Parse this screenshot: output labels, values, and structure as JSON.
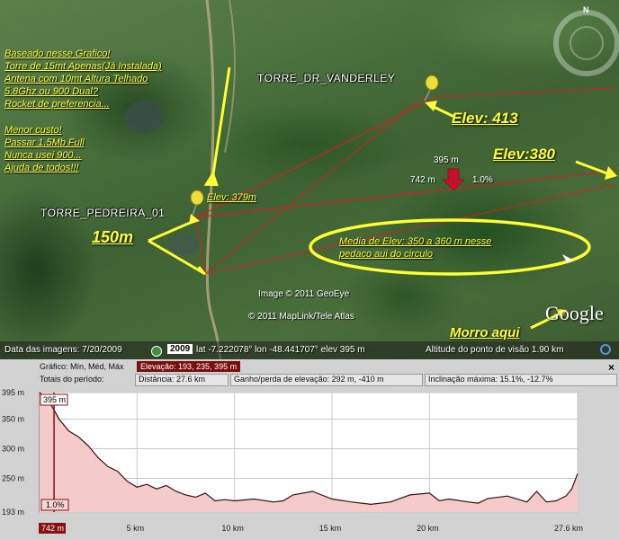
{
  "colors": {
    "annotation_yellow": "#ffff33",
    "path_red": "#d62020",
    "profile_fill": "#f4caca",
    "panel_bg": "#d2d2d2",
    "marker_red": "#c8102e"
  },
  "map": {
    "compass_n": "N",
    "annotations": {
      "note_lines": [
        "Baseado nesse Grafico!",
        "Torre de 15mt Apenas(Já Instalada)",
        "Antena com 10mt Altura Telhado",
        "5.8Ghz ou 900 Dual?",
        "Rocket de preferencia..."
      ],
      "cost_lines": [
        "Menor custo!",
        "Passar 1.5Mb Full",
        "Nunca usei 900...",
        "Ajuda de todos!!!"
      ],
      "elev_413": "Elev: 413",
      "elev_380": "Elev:380",
      "elev_379": "Elev: 379m",
      "dist_150": "150m",
      "circle_note_1": "Media de Elev: 350 a 360 m nesse",
      "circle_note_2": "pedaco aui do circulo",
      "morro": "Morro aqui"
    },
    "places": {
      "tower_dr": "TORRE_DR_VANDERLEY",
      "tower_pedreira": "TORRE_PEDREIRA_01"
    },
    "cursor_readout": {
      "elev": "395 m",
      "dist": "742 m",
      "slope": "1.0%"
    },
    "credits": {
      "geoeye": "Image © 2011 GeoEye",
      "maplink": "© 2011 MapLink/Tele Atlas",
      "google": "Google"
    },
    "status": {
      "image_date": "Data das imagens: 7/20/2009",
      "year_badge": "2009",
      "coords": "lat  -7.222078°  lon  -48.441707°  elev  395 m",
      "eye_alt": "Altitude do ponto de visão    1.90 km"
    }
  },
  "profile": {
    "legend": "Gráfico: Mín, Méd, Máx",
    "elev_box": "Elevação: 193, 235, 395 m",
    "totals_label": "Totais do período:",
    "distance": "Distância: 27.6 km",
    "gain_loss": "Ganho/perda de elevação: 292 m, -410 m",
    "max_slope": "Inclinação máxima: 15.1%, -12.7%",
    "close": "×",
    "cursor_value": "395 m",
    "cursor_slope": "1.0%",
    "cursor_x_label": "742 m"
  },
  "chart_data": {
    "type": "area",
    "title": "",
    "xlabel": "",
    "ylabel": "",
    "x_unit": "km",
    "y_unit": "m",
    "xlim": [
      0,
      27.6
    ],
    "ylim": [
      193,
      395
    ],
    "y_ticks": [
      "395 m",
      "350 m",
      "300 m",
      "250 m",
      "193 m"
    ],
    "y_tick_values": [
      395,
      350,
      300,
      250,
      193
    ],
    "x_ticks": [
      "5 km",
      "10 km",
      "15 km",
      "20 km",
      "27.6 km"
    ],
    "x_tick_values": [
      5,
      10,
      15,
      20,
      27.6
    ],
    "series": [
      {
        "x": [
          0,
          0.5,
          1,
          1.5,
          2,
          2.5,
          3,
          3.5,
          4,
          4.5,
          5,
          5.5,
          6,
          6.5,
          7,
          7.5,
          8,
          8.5,
          9,
          9.5,
          10,
          11,
          12,
          12.5,
          13,
          14,
          15,
          16,
          17,
          18,
          19,
          20,
          20.5,
          21,
          22,
          22.5,
          23,
          24,
          25,
          25.5,
          26,
          26.5,
          27,
          27.3,
          27.6
        ],
        "y": [
          395,
          380,
          350,
          330,
          320,
          305,
          285,
          270,
          262,
          245,
          235,
          240,
          232,
          238,
          228,
          222,
          218,
          225,
          212,
          214,
          212,
          215,
          210,
          212,
          222,
          228,
          215,
          210,
          206,
          210,
          222,
          225,
          212,
          215,
          210,
          208,
          216,
          220,
          210,
          228,
          210,
          212,
          220,
          232,
          258
        ]
      }
    ]
  }
}
